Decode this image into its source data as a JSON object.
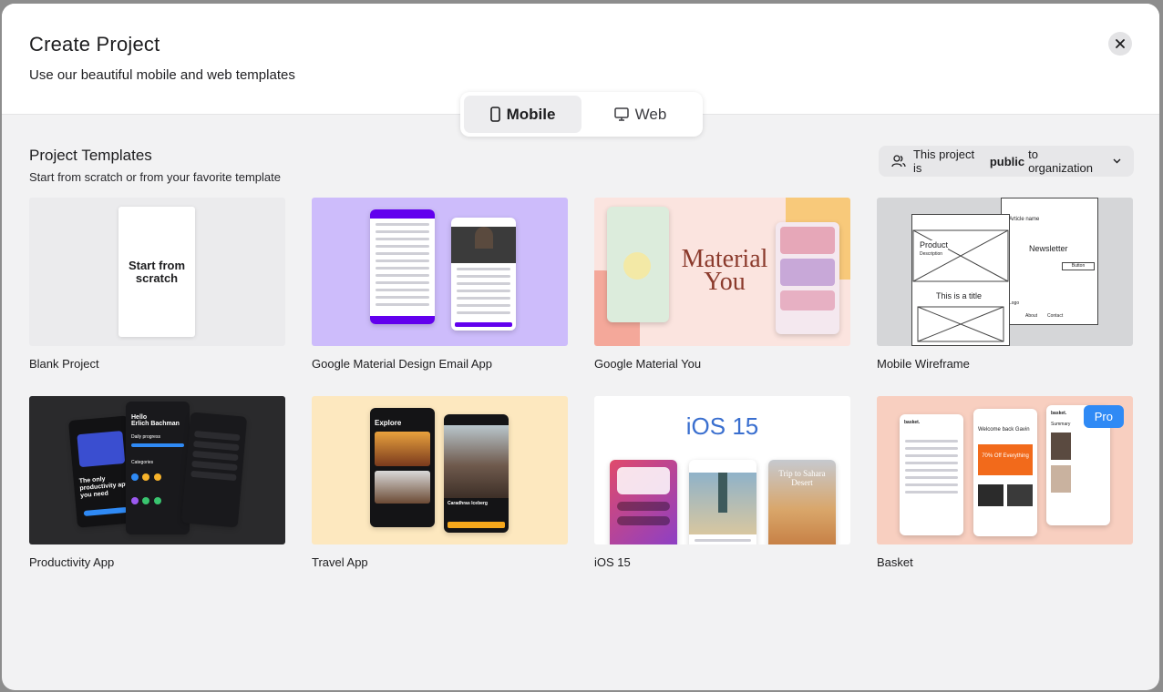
{
  "header": {
    "title": "Create Project",
    "subtitle": "Use our beautiful mobile and web templates"
  },
  "toggle": {
    "mobile_label": "Mobile",
    "web_label": "Web",
    "selected": "Mobile"
  },
  "section": {
    "title": "Project Templates",
    "subtitle": "Start from scratch or from your favorite template"
  },
  "visibility": {
    "prefix": "This project is",
    "emphasis": "public",
    "suffix": "to organization"
  },
  "templates": [
    {
      "label": "Blank Project",
      "thumb_text": "Start from scratch"
    },
    {
      "label": "Google Material Design Email App"
    },
    {
      "label": "Google Material You",
      "thumb_text": "Material You"
    },
    {
      "label": "Mobile Wireframe",
      "thumb_texts": [
        "Product",
        "Description",
        "Newsletter",
        "This is a title",
        "Article name",
        "Button",
        "Logo",
        "About",
        "Contact"
      ]
    },
    {
      "label": "Productivity App",
      "thumb_texts": [
        "Hello",
        "Erlich Bachman",
        "Daily progress",
        "Categories",
        "The only productivity app you need"
      ]
    },
    {
      "label": "Travel App",
      "thumb_texts": [
        "Explore",
        "Caradhras Iceberg"
      ]
    },
    {
      "label": "iOS 15",
      "thumb_text": "iOS 15",
      "thumb_texts": [
        "Trip to Sahara Desert"
      ]
    },
    {
      "label": "Basket",
      "badge": "Pro",
      "thumb_texts": [
        "basket.",
        "Welcome back Gavin",
        "70% Off Everything",
        "Summary"
      ]
    }
  ],
  "colors": {
    "accent": "#2f8af5",
    "material_purple": "#6200ee",
    "material_you_text": "#8b3a2c"
  }
}
